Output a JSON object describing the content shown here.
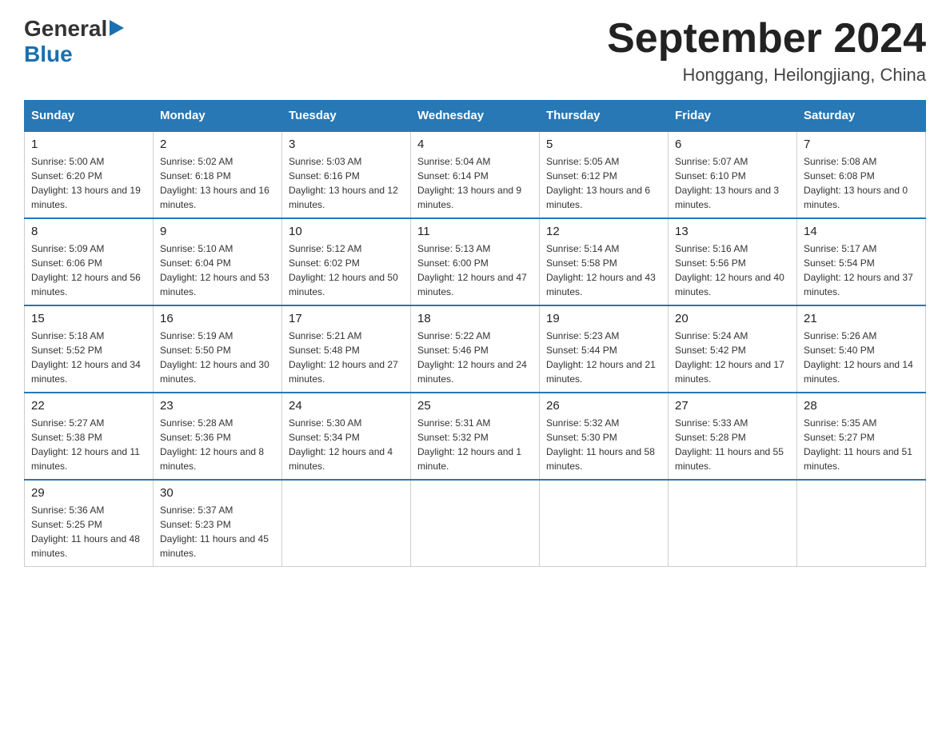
{
  "logo": {
    "text_general": "General",
    "triangle": "▶",
    "text_blue": "Blue"
  },
  "title": {
    "month_year": "September 2024",
    "location": "Honggang, Heilongjiang, China"
  },
  "days_header": [
    "Sunday",
    "Monday",
    "Tuesday",
    "Wednesday",
    "Thursday",
    "Friday",
    "Saturday"
  ],
  "weeks": [
    [
      {
        "day": "1",
        "sunrise": "Sunrise: 5:00 AM",
        "sunset": "Sunset: 6:20 PM",
        "daylight": "Daylight: 13 hours and 19 minutes."
      },
      {
        "day": "2",
        "sunrise": "Sunrise: 5:02 AM",
        "sunset": "Sunset: 6:18 PM",
        "daylight": "Daylight: 13 hours and 16 minutes."
      },
      {
        "day": "3",
        "sunrise": "Sunrise: 5:03 AM",
        "sunset": "Sunset: 6:16 PM",
        "daylight": "Daylight: 13 hours and 12 minutes."
      },
      {
        "day": "4",
        "sunrise": "Sunrise: 5:04 AM",
        "sunset": "Sunset: 6:14 PM",
        "daylight": "Daylight: 13 hours and 9 minutes."
      },
      {
        "day": "5",
        "sunrise": "Sunrise: 5:05 AM",
        "sunset": "Sunset: 6:12 PM",
        "daylight": "Daylight: 13 hours and 6 minutes."
      },
      {
        "day": "6",
        "sunrise": "Sunrise: 5:07 AM",
        "sunset": "Sunset: 6:10 PM",
        "daylight": "Daylight: 13 hours and 3 minutes."
      },
      {
        "day": "7",
        "sunrise": "Sunrise: 5:08 AM",
        "sunset": "Sunset: 6:08 PM",
        "daylight": "Daylight: 13 hours and 0 minutes."
      }
    ],
    [
      {
        "day": "8",
        "sunrise": "Sunrise: 5:09 AM",
        "sunset": "Sunset: 6:06 PM",
        "daylight": "Daylight: 12 hours and 56 minutes."
      },
      {
        "day": "9",
        "sunrise": "Sunrise: 5:10 AM",
        "sunset": "Sunset: 6:04 PM",
        "daylight": "Daylight: 12 hours and 53 minutes."
      },
      {
        "day": "10",
        "sunrise": "Sunrise: 5:12 AM",
        "sunset": "Sunset: 6:02 PM",
        "daylight": "Daylight: 12 hours and 50 minutes."
      },
      {
        "day": "11",
        "sunrise": "Sunrise: 5:13 AM",
        "sunset": "Sunset: 6:00 PM",
        "daylight": "Daylight: 12 hours and 47 minutes."
      },
      {
        "day": "12",
        "sunrise": "Sunrise: 5:14 AM",
        "sunset": "Sunset: 5:58 PM",
        "daylight": "Daylight: 12 hours and 43 minutes."
      },
      {
        "day": "13",
        "sunrise": "Sunrise: 5:16 AM",
        "sunset": "Sunset: 5:56 PM",
        "daylight": "Daylight: 12 hours and 40 minutes."
      },
      {
        "day": "14",
        "sunrise": "Sunrise: 5:17 AM",
        "sunset": "Sunset: 5:54 PM",
        "daylight": "Daylight: 12 hours and 37 minutes."
      }
    ],
    [
      {
        "day": "15",
        "sunrise": "Sunrise: 5:18 AM",
        "sunset": "Sunset: 5:52 PM",
        "daylight": "Daylight: 12 hours and 34 minutes."
      },
      {
        "day": "16",
        "sunrise": "Sunrise: 5:19 AM",
        "sunset": "Sunset: 5:50 PM",
        "daylight": "Daylight: 12 hours and 30 minutes."
      },
      {
        "day": "17",
        "sunrise": "Sunrise: 5:21 AM",
        "sunset": "Sunset: 5:48 PM",
        "daylight": "Daylight: 12 hours and 27 minutes."
      },
      {
        "day": "18",
        "sunrise": "Sunrise: 5:22 AM",
        "sunset": "Sunset: 5:46 PM",
        "daylight": "Daylight: 12 hours and 24 minutes."
      },
      {
        "day": "19",
        "sunrise": "Sunrise: 5:23 AM",
        "sunset": "Sunset: 5:44 PM",
        "daylight": "Daylight: 12 hours and 21 minutes."
      },
      {
        "day": "20",
        "sunrise": "Sunrise: 5:24 AM",
        "sunset": "Sunset: 5:42 PM",
        "daylight": "Daylight: 12 hours and 17 minutes."
      },
      {
        "day": "21",
        "sunrise": "Sunrise: 5:26 AM",
        "sunset": "Sunset: 5:40 PM",
        "daylight": "Daylight: 12 hours and 14 minutes."
      }
    ],
    [
      {
        "day": "22",
        "sunrise": "Sunrise: 5:27 AM",
        "sunset": "Sunset: 5:38 PM",
        "daylight": "Daylight: 12 hours and 11 minutes."
      },
      {
        "day": "23",
        "sunrise": "Sunrise: 5:28 AM",
        "sunset": "Sunset: 5:36 PM",
        "daylight": "Daylight: 12 hours and 8 minutes."
      },
      {
        "day": "24",
        "sunrise": "Sunrise: 5:30 AM",
        "sunset": "Sunset: 5:34 PM",
        "daylight": "Daylight: 12 hours and 4 minutes."
      },
      {
        "day": "25",
        "sunrise": "Sunrise: 5:31 AM",
        "sunset": "Sunset: 5:32 PM",
        "daylight": "Daylight: 12 hours and 1 minute."
      },
      {
        "day": "26",
        "sunrise": "Sunrise: 5:32 AM",
        "sunset": "Sunset: 5:30 PM",
        "daylight": "Daylight: 11 hours and 58 minutes."
      },
      {
        "day": "27",
        "sunrise": "Sunrise: 5:33 AM",
        "sunset": "Sunset: 5:28 PM",
        "daylight": "Daylight: 11 hours and 55 minutes."
      },
      {
        "day": "28",
        "sunrise": "Sunrise: 5:35 AM",
        "sunset": "Sunset: 5:27 PM",
        "daylight": "Daylight: 11 hours and 51 minutes."
      }
    ],
    [
      {
        "day": "29",
        "sunrise": "Sunrise: 5:36 AM",
        "sunset": "Sunset: 5:25 PM",
        "daylight": "Daylight: 11 hours and 48 minutes."
      },
      {
        "day": "30",
        "sunrise": "Sunrise: 5:37 AM",
        "sunset": "Sunset: 5:23 PM",
        "daylight": "Daylight: 11 hours and 45 minutes."
      },
      null,
      null,
      null,
      null,
      null
    ]
  ]
}
